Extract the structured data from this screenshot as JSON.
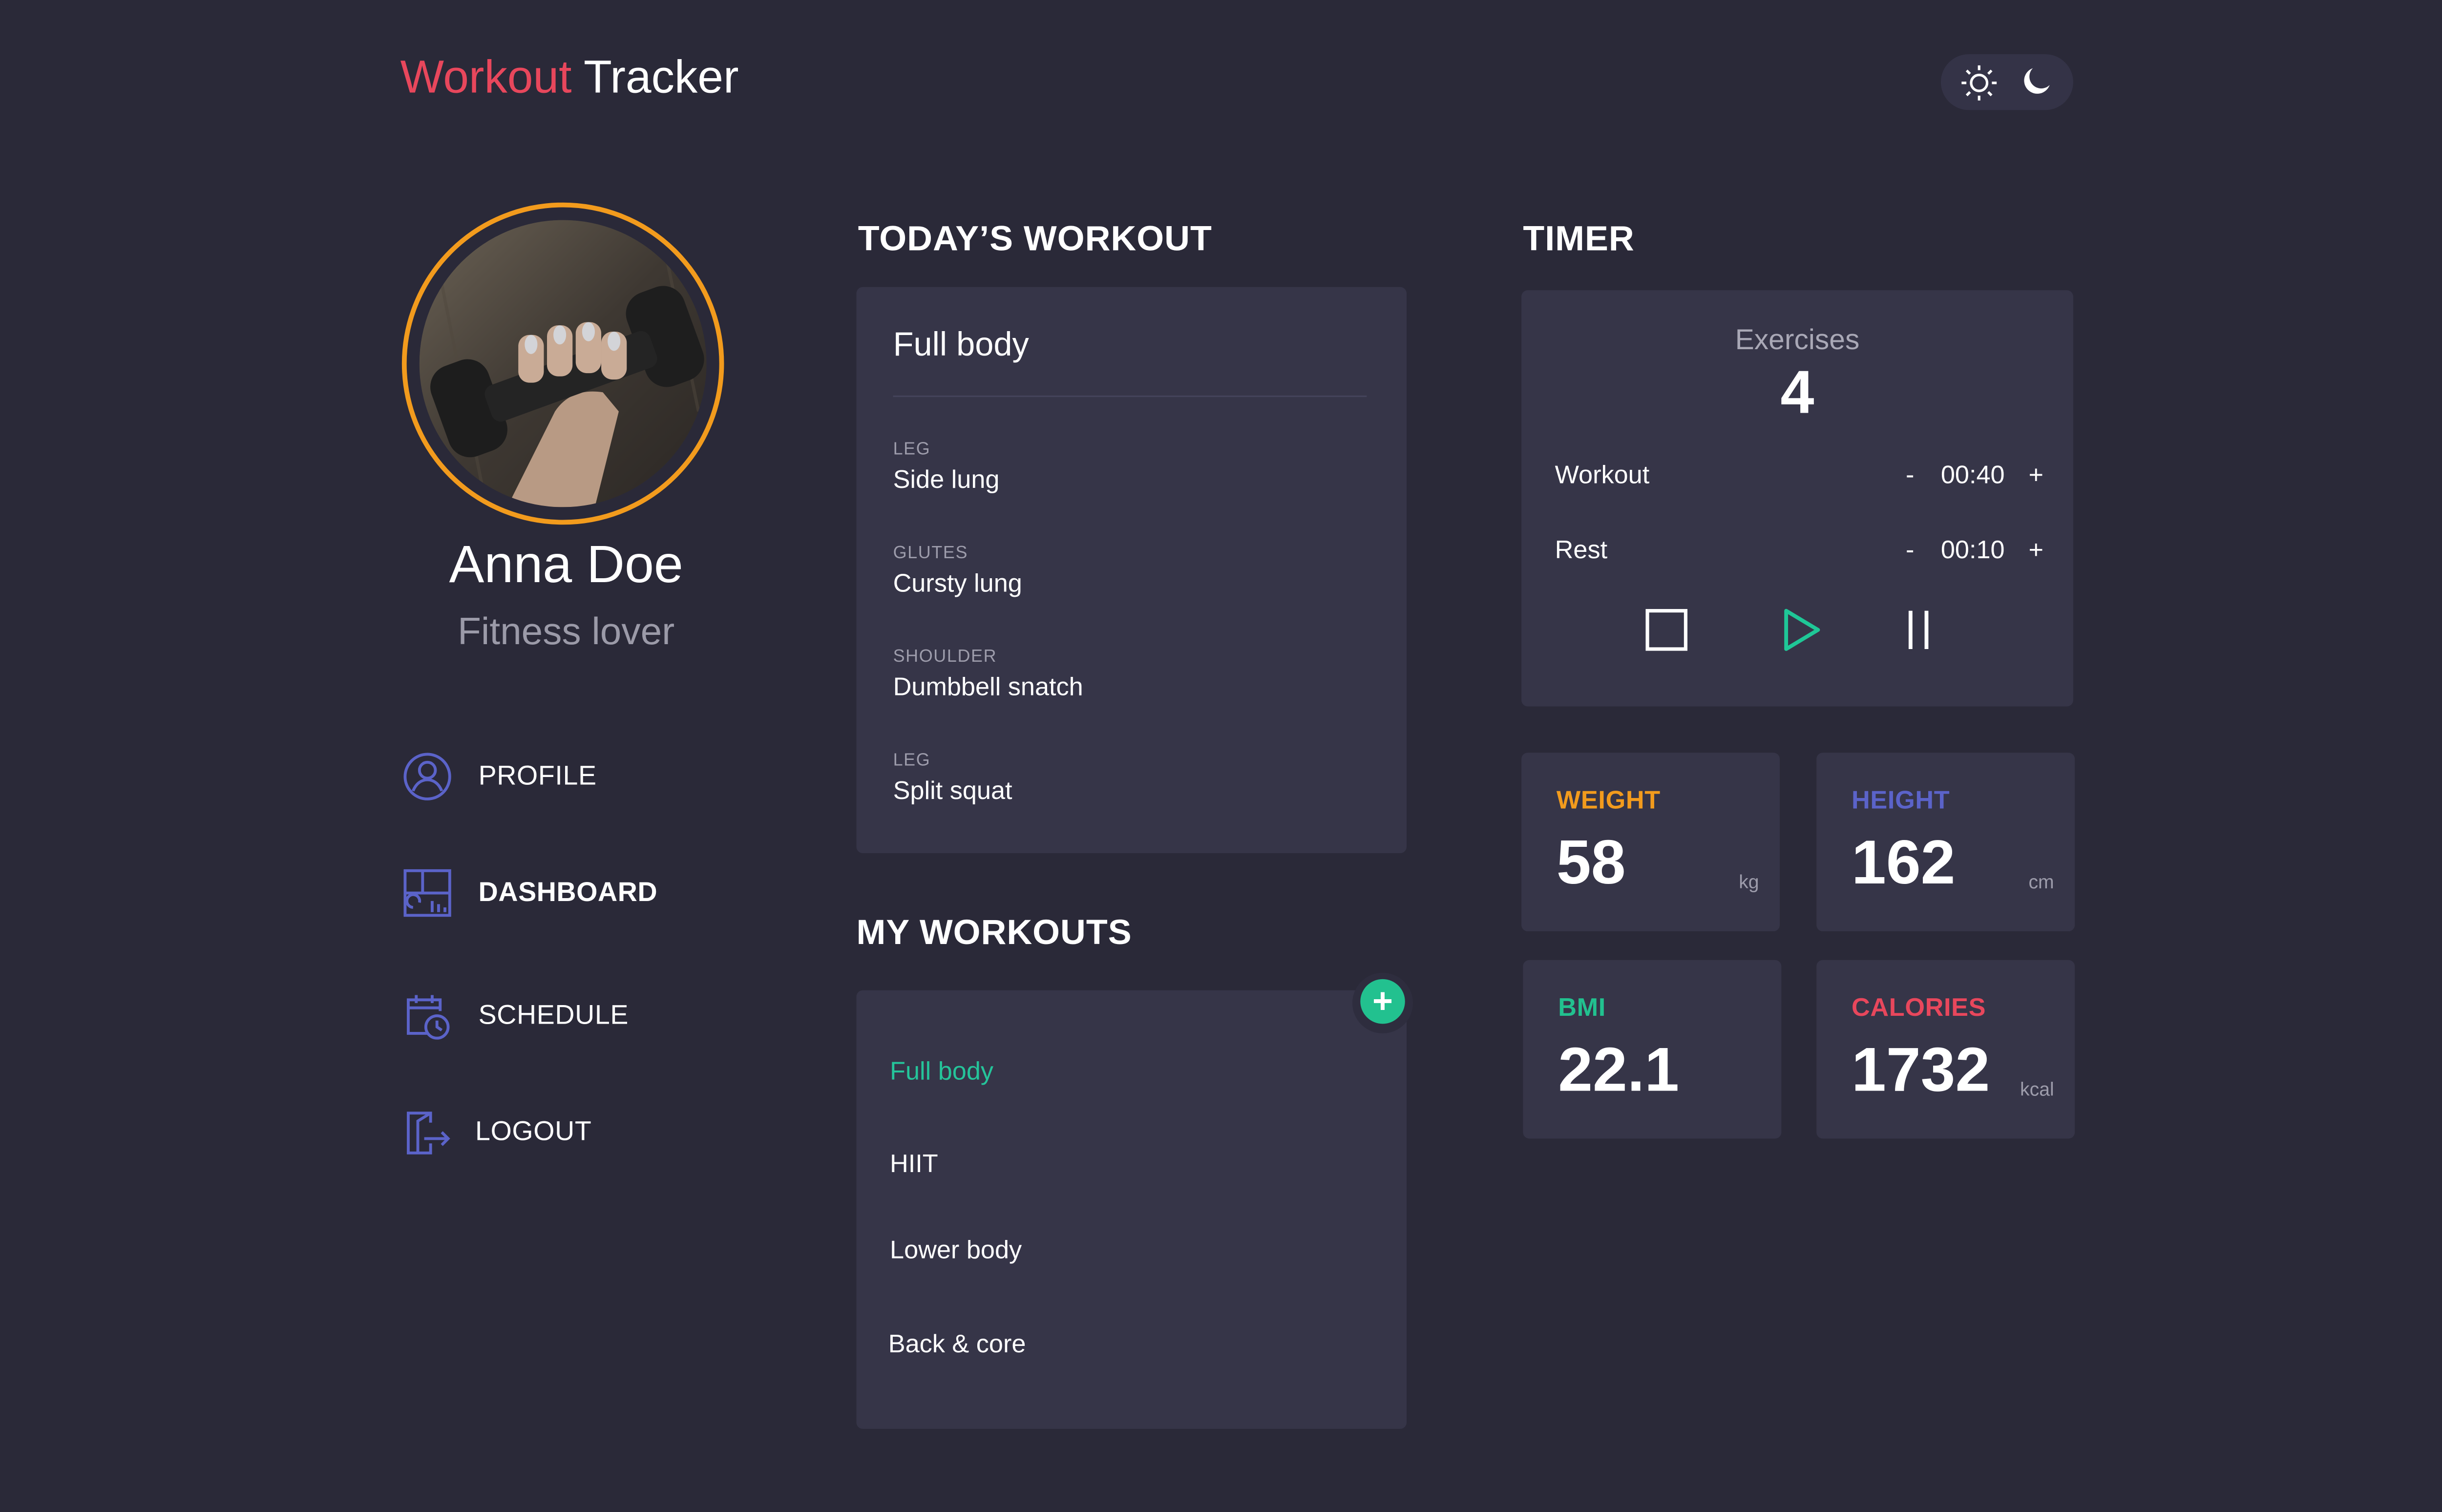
{
  "header": {
    "logo_accent": "Workout",
    "logo_rest": " Tracker"
  },
  "theme_toggle": {
    "light_icon": "sun-icon",
    "dark_icon": "moon-icon"
  },
  "profile": {
    "name": "Anna Doe",
    "tagline": "Fitness lover",
    "ring_color": "#f29b1d"
  },
  "nav": {
    "items": [
      {
        "label": "PROFILE",
        "icon": "user-circle-icon"
      },
      {
        "label": "DASHBOARD",
        "icon": "dashboard-icon",
        "active": true
      },
      {
        "label": "SCHEDULE",
        "icon": "calendar-clock-icon"
      },
      {
        "label": "LOGOUT",
        "icon": "logout-icon"
      }
    ]
  },
  "today": {
    "title": "TODAY’S WORKOUT",
    "workout_name": "Full body",
    "exercises": [
      {
        "category": "LEG",
        "name": "Side lung"
      },
      {
        "category": "GLUTES",
        "name": "Cursty lung"
      },
      {
        "category": "SHOULDER",
        "name": "Dumbbell snatch"
      },
      {
        "category": "LEG",
        "name": "Split squat"
      }
    ]
  },
  "my_workouts": {
    "title": "MY WORKOUTS",
    "add_label": "+",
    "items": [
      "Full body",
      "HIIT",
      "Lower body",
      "Back & core"
    ],
    "selected": "Full body"
  },
  "timer": {
    "title": "TIMER",
    "exercises_label": "Exercises",
    "exercises_count": "4",
    "rows": [
      {
        "label": "Workout",
        "minus": "-",
        "time": "00:40",
        "plus": "+"
      },
      {
        "label": "Rest",
        "minus": "-",
        "time": "00:10",
        "plus": "+"
      }
    ],
    "controls": [
      "stop-icon",
      "play-icon",
      "pause-icon"
    ],
    "play_color": "#1fc797"
  },
  "stats": {
    "weight": {
      "label": "WEIGHT",
      "value": "58",
      "unit": "kg",
      "color": "#f29b1d"
    },
    "height": {
      "label": "HEIGHT",
      "value": "162",
      "unit": "cm",
      "color": "#5b63c9"
    },
    "bmi": {
      "label": "BMI",
      "value": "22.1",
      "unit": "",
      "color": "#22c18f"
    },
    "calories": {
      "label": "CALORIES",
      "value": "1732",
      "unit": "kcal",
      "color": "#e8475c"
    }
  },
  "colors": {
    "background": "#2a2938",
    "card": "#363548",
    "icon_accent": "#5b63c9",
    "brand_red": "#e8475c"
  }
}
